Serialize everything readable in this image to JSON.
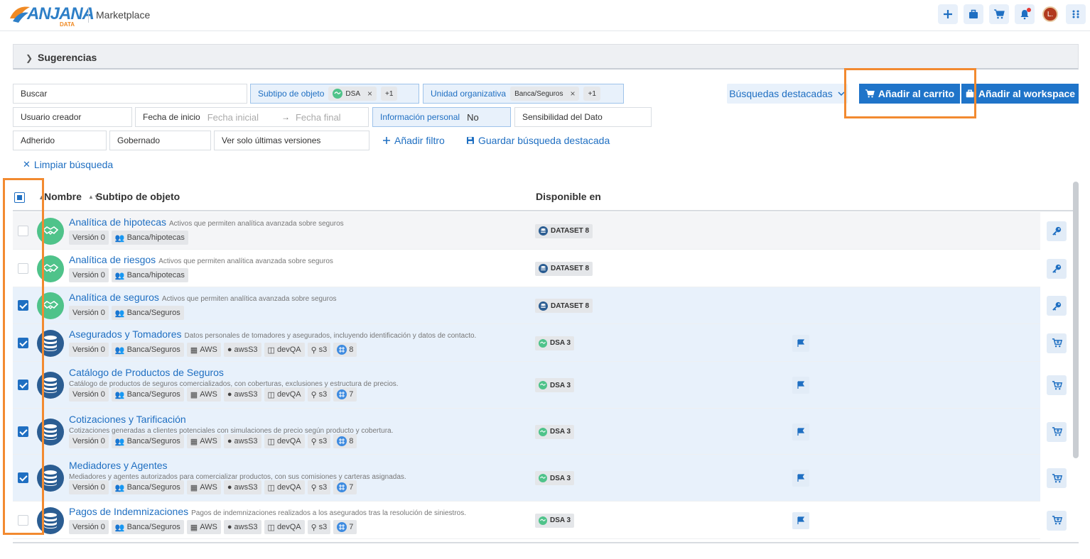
{
  "header": {
    "logo_text": "ANJANA",
    "logo_sub": "DATA",
    "app_title": "Marketplace",
    "avatar_initial": "L."
  },
  "suggestions": {
    "label": "Sugerencias"
  },
  "filters": {
    "search": "Buscar",
    "subtype_label": "Subtipo de objeto",
    "subtype_chip": "DSA",
    "subtype_more": "+1",
    "org_label": "Unidad organizativa",
    "org_chip": "Banca/Seguros",
    "org_more": "+1",
    "creator": "Usuario creador",
    "start_label": "Fecha de inicio",
    "start_placeholder": "Fecha inicial",
    "end_placeholder": "Fecha final",
    "personal_label": "Información personal",
    "personal_value": "No",
    "sensitivity": "Sensibilidad del Dato",
    "adhered": "Adherido",
    "governed": "Gobernado",
    "latest": "Ver solo últimas versiones",
    "add_filter": "Añadir filtro",
    "save_search": "Guardar búsqueda destacada",
    "clear": "Limpiar búsqueda"
  },
  "actions": {
    "featured": "Búsquedas destacadas",
    "add_cart": "Añadir al carrito",
    "add_workspace": "Añadir al workspace"
  },
  "table": {
    "col_name": "Nombre",
    "col_subtype": "Subtipo de objeto",
    "col_available": "Disponible en",
    "rows": [
      {
        "name": "Analítica de hipotecas",
        "desc": "Activos que permiten analítica avanzada sobre seguros",
        "version": "Versión 0",
        "org": "Banca/hipotecas",
        "avail": "DATASET 8",
        "checked": false
      },
      {
        "name": "Analítica de riesgos",
        "desc": "Activos que permiten analítica avanzada sobre seguros",
        "version": "Versión 0",
        "org": "Banca/hipotecas",
        "avail": "DATASET 8",
        "checked": false
      },
      {
        "name": "Analítica de seguros",
        "desc": "Activos que permiten analítica avanzada sobre seguros",
        "version": "Versión 0",
        "org": "Banca/Seguros",
        "avail": "DATASET 8",
        "checked": true
      },
      {
        "name": "Asegurados y Tomadores",
        "desc": "Datos personales de tomadores y asegurados, incluyendo identificación y datos de contacto.",
        "version": "Versión 0",
        "org": "Banca/Seguros",
        "t1": "AWS",
        "t2": "awsS3",
        "t3": "devQA",
        "t4": "s3",
        "t5": "8",
        "avail": "DSA 3",
        "checked": true
      },
      {
        "name": "Catálogo de Productos de Seguros",
        "desc": "Catálogo de productos de seguros comercializados, con coberturas, exclusiones y estructura de precios.",
        "version": "Versión 0",
        "org": "Banca/Seguros",
        "t1": "AWS",
        "t2": "awsS3",
        "t3": "devQA",
        "t4": "s3",
        "t5": "7",
        "avail": "DSA 3",
        "checked": true
      },
      {
        "name": "Cotizaciones y Tarificación",
        "desc": "Cotizaciones generadas a clientes potenciales con simulaciones de precio según producto y cobertura.",
        "version": "Versión 0",
        "org": "Banca/Seguros",
        "t1": "AWS",
        "t2": "awsS3",
        "t3": "devQA",
        "t4": "s3",
        "t5": "8",
        "avail": "DSA 3",
        "checked": true
      },
      {
        "name": "Mediadores y Agentes",
        "desc": "Mediadores y agentes autorizados para comercializar productos, con sus comisiones y carteras asignadas.",
        "version": "Versión 0",
        "org": "Banca/Seguros",
        "t1": "AWS",
        "t2": "awsS3",
        "t3": "devQA",
        "t4": "s3",
        "t5": "7",
        "avail": "DSA 3",
        "checked": true
      },
      {
        "name": "Pagos de Indemnizaciones",
        "desc": "Pagos de indemnizaciones realizados a los asegurados tras la resolución de siniestros.",
        "version": "Versión 0",
        "org": "Banca/Seguros",
        "t1": "AWS",
        "t2": "awsS3",
        "t3": "devQA",
        "t4": "s3",
        "t5": "7",
        "avail": "DSA 3",
        "checked": false
      }
    ]
  },
  "colors": {
    "accent": "#1f74c9",
    "highlight": "#f28a30",
    "selected_row": "#e8f1fb"
  }
}
